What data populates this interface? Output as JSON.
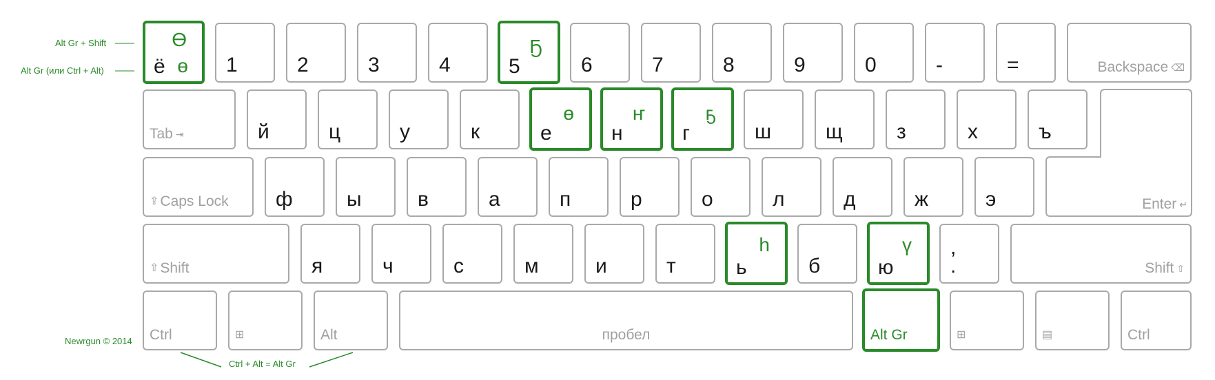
{
  "annotations": {
    "shift_layer": "Alt Gr + Shift",
    "altgr_layer": "Alt Gr (или Ctrl + Alt)",
    "copyright": "Newrgun © 2014",
    "ctrl_alt": "Ctrl + Alt = Alt Gr"
  },
  "row1": {
    "yo": "ё",
    "yo_alt": "ө",
    "yo_shift_alt": "Ө",
    "k1": "1",
    "k2": "2",
    "k3": "3",
    "k4": "4",
    "k5": "5",
    "k5_alt": "Ҕ",
    "k6": "6",
    "k7": "7",
    "k8": "8",
    "k9": "9",
    "k0": "0",
    "minus": "-",
    "equals": "=",
    "backspace": "Backspace"
  },
  "row2": {
    "tab": "Tab",
    "y": "й",
    "ts": "ц",
    "u": "у",
    "k": "к",
    "e": "е",
    "e_alt": "ө",
    "n": "н",
    "n_alt": "ҥ",
    "g": "г",
    "g_alt": "ҕ",
    "sh": "ш",
    "shch": "щ",
    "z": "з",
    "kh": "х",
    "hard": "ъ"
  },
  "row3": {
    "caps": "Caps Lock",
    "f": "ф",
    "yi": "ы",
    "v": "в",
    "a": "а",
    "p": "п",
    "r": "р",
    "o": "о",
    "l": "л",
    "d": "д",
    "zh": "ж",
    "ee": "э",
    "enter": "Enter"
  },
  "row4": {
    "shift_l": "Shift",
    "ya": "я",
    "ch": "ч",
    "s": "с",
    "m": "м",
    "i": "и",
    "t": "т",
    "soft": "ь",
    "soft_alt": "һ",
    "b": "б",
    "yu": "ю",
    "yu_alt": "ү",
    "comma": ",",
    "period": ".",
    "shift_r": "Shift"
  },
  "row5": {
    "ctrl_l": "Ctrl",
    "alt_l": "Alt",
    "space": "пробел",
    "altgr": "Alt Gr",
    "ctrl_r": "Ctrl"
  },
  "icons": {
    "win": "windows-icon",
    "menu": "menu-icon",
    "backspace": "backspace-icon",
    "tab": "tab-icon",
    "caps": "caps-lock-arrow-icon",
    "enter": "enter-icon",
    "shift": "shift-arrow-icon"
  },
  "colors": {
    "accent": "#2a8a2a",
    "key_border": "#a9a9a9",
    "modifier_text": "#a0a0a0"
  }
}
